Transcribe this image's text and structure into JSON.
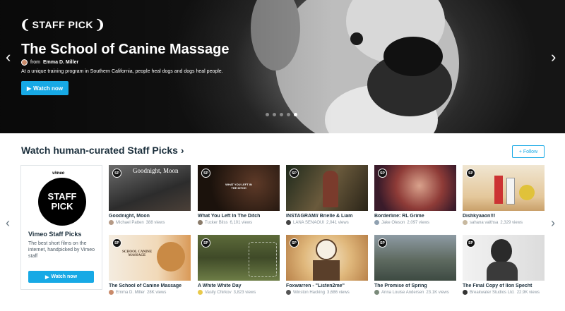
{
  "hero": {
    "logo": "STAFF PICK",
    "title": "The School of Canine Massage",
    "byline_from": "from",
    "author": "Emma D. Miller",
    "description": "At a unique training program in Southern California, people heal dogs and dogs heal people.",
    "cta": "Watch now",
    "carousel": {
      "slides": 5,
      "active": 5
    }
  },
  "section": {
    "title": "Watch human-curated Staff Picks ›",
    "follow": "+ Follow"
  },
  "channel_card": {
    "brand": "vimeo",
    "badge_top": "STAFF",
    "badge_bottom": "PICK",
    "name": "Vimeo Staff Picks",
    "description": "The best short films on the internet, handpicked by Vimeo staff",
    "cta": "Watch now"
  },
  "videos": [
    {
      "title": "Goodnight, Moon",
      "author": "Michael Patten",
      "views": "388 views",
      "thumb_text": "Goodnight, Moon"
    },
    {
      "title": "What You Left In The Ditch",
      "author": "Tucker Bliss",
      "views": "6,101 views",
      "thumb_text": "WHAT YOU LEFT IN THE DITCH"
    },
    {
      "title": "INSTAGRAM// Brielle & Liam",
      "author": "LANA SENAOUI",
      "views": "2,041 views",
      "thumb_text": ""
    },
    {
      "title": "Borderline: RL Grime",
      "author": "Jake Oleson",
      "views": "2,097 views",
      "thumb_text": ""
    },
    {
      "title": "Dishkyaaon!!!",
      "author": "sahana vaithsa",
      "views": "2,329 views",
      "thumb_text": ""
    },
    {
      "title": "The School of Canine Massage",
      "author": "Emma D. Miller",
      "views": "28K views",
      "thumb_text": "SCHOOL CANINE MASSAGE"
    },
    {
      "title": "A White White Day",
      "author": "Vasily Chirkov",
      "views": "3,823 views",
      "thumb_text": ""
    },
    {
      "title": "Foxwarren - \"Listen2me\"",
      "author": "Winston Hacking",
      "views": "3,686 views",
      "thumb_text": ""
    },
    {
      "title": "The Promise of Spring",
      "author": "Anna Louise Andersen",
      "views": "23.1K views",
      "thumb_text": ""
    },
    {
      "title": "The Final Copy of Ilon Specht",
      "author": "Breakwater Studios Ltd.",
      "views": "22.9K views",
      "thumb_text": ""
    }
  ],
  "badge_text": "SP",
  "colors": {
    "accent": "#17a9e5",
    "title": "#1a2e3b",
    "meta": "#8a96a0"
  },
  "icons": {
    "prev": "chevron-left-icon",
    "next": "chevron-right-icon",
    "play": "play-icon"
  }
}
